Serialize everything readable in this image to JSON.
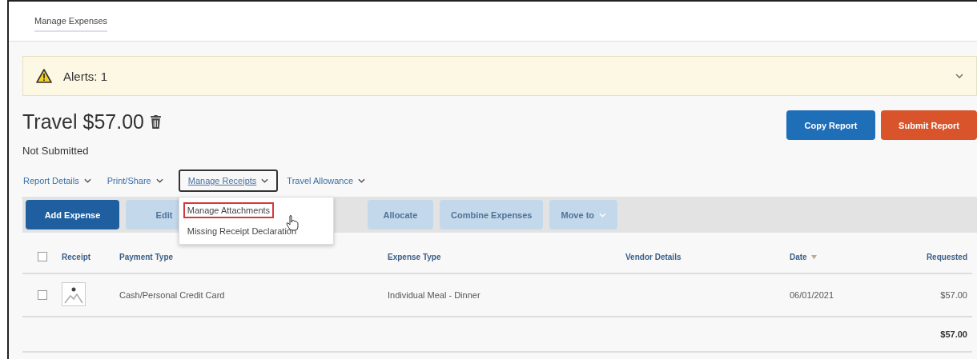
{
  "tab": {
    "label": "Manage Expenses",
    "selected": true
  },
  "alert": {
    "label": "Alerts: 1",
    "expanded": false
  },
  "report": {
    "title": "Travel $57.00",
    "status": "Not Submitted"
  },
  "actions": [
    {
      "label": "Copy Report",
      "kind": "primary"
    },
    {
      "label": "Submit Report",
      "kind": "danger"
    }
  ],
  "menus": [
    {
      "label": "Report Details",
      "open": false
    },
    {
      "label": "Print/Share",
      "open": false
    },
    {
      "label": "Manage Receipts",
      "open": true
    },
    {
      "label": "Travel Allowance",
      "open": false
    }
  ],
  "dropdown": [
    {
      "label": "Manage Attachments",
      "selected": true
    },
    {
      "label": "Missing Receipt Declaration",
      "selected": false
    }
  ],
  "toolbar": [
    {
      "label": "Add Expense",
      "disabled": false,
      "caret": false
    },
    {
      "label": "Edit",
      "disabled": true,
      "caret": false
    },
    {
      "label": "Allocate",
      "disabled": true,
      "caret": false
    },
    {
      "label": "Combine Expenses",
      "disabled": true,
      "caret": false
    },
    {
      "label": "Move to",
      "disabled": true,
      "caret": true
    }
  ],
  "select_all": {
    "checked": false
  },
  "table": {
    "columns": [
      "Receipt",
      "Payment Type",
      "Expense Type",
      "Vendor Details",
      "Date",
      "Requested"
    ],
    "rows": [
      {
        "checked": false,
        "payment_type": "Cash/Personal Credit Card",
        "expense_type": "Individual Meal - Dinner",
        "date": "06/01/2021",
        "requested": "$57.00"
      }
    ],
    "total": "$57.00"
  }
}
